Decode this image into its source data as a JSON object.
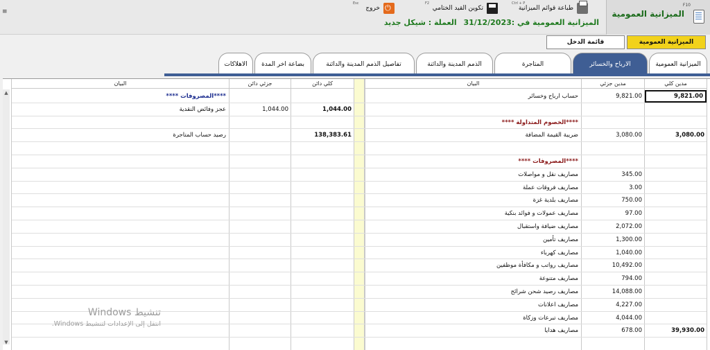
{
  "window": {
    "title": "الميزانية العمومية",
    "shortcut": "F10"
  },
  "toolbar": {
    "print_label": "طباعة قوائم الميزانية",
    "print_shortcut": "Ctrl + P",
    "closing_entry_label": "تكوين القيد الختامي",
    "closing_entry_shortcut": "F2",
    "exit_label": "خروج",
    "exit_shortcut": "Esc"
  },
  "subline": {
    "balance_date": "الميزانية العمومية في :31/12/2023",
    "currency": "العملة : شيكل جديد"
  },
  "report_buttons": {
    "balance_sheet": "الميزانية العمومية",
    "income_statement": "قائمة الدخل"
  },
  "tabs": [
    "الميزانية العمومية",
    "الارباح والخسائر",
    "المتاجرة",
    "الذمم المدينة والدائنة",
    "تفاصيل الذمم المدينة والدائنة",
    "بضاعة اخر المدة",
    "الاهلاكات"
  ],
  "grid": {
    "headers": {
      "debit_total": "مدين كلي",
      "debit_partial": "مدين جزئي",
      "desc_right": "البيان",
      "credit_total": "كلي دائن",
      "credit_partial": "جزئي دائن",
      "desc_left": "البيان"
    },
    "right_rows": [
      {
        "desc": "حساب ارباح وخسائر",
        "partial": "9,821.00",
        "total": "9,821.00",
        "style": "normal"
      },
      {
        "desc": "",
        "partial": "",
        "total": "",
        "style": "normal"
      },
      {
        "desc": "****الخصوم المتداولة ****",
        "partial": "",
        "total": "",
        "style": "red"
      },
      {
        "desc": "ضريبة القيمة المضافة",
        "partial": "3,080.00",
        "total": "3,080.00",
        "style": "normal"
      },
      {
        "desc": "",
        "partial": "",
        "total": "",
        "style": "normal"
      },
      {
        "desc": "****المصروفات ****",
        "partial": "",
        "total": "",
        "style": "red"
      },
      {
        "desc": "مصاريف نقل و مواصلات",
        "partial": "345.00",
        "total": "",
        "style": "normal"
      },
      {
        "desc": "مصاريف فروقات عملة",
        "partial": "3.00",
        "total": "",
        "style": "normal"
      },
      {
        "desc": "مصاريف بلدية غزة",
        "partial": "750.00",
        "total": "",
        "style": "normal"
      },
      {
        "desc": "مصاريف عمولات و فوائد بنكية",
        "partial": "97.00",
        "total": "",
        "style": "normal"
      },
      {
        "desc": "مصاريف ضيافة واستقبال",
        "partial": "2,072.00",
        "total": "",
        "style": "normal"
      },
      {
        "desc": "مصاريف تأمين",
        "partial": "1,300.00",
        "total": "",
        "style": "normal"
      },
      {
        "desc": "مصاريف كهرباء",
        "partial": "1,040.00",
        "total": "",
        "style": "normal"
      },
      {
        "desc": "مصاريف رواتب و مكافأة موظفين",
        "partial": "10,492.00",
        "total": "",
        "style": "normal"
      },
      {
        "desc": "مصاريف متنوعة",
        "partial": "794.00",
        "total": "",
        "style": "normal"
      },
      {
        "desc": "مصاريف رصيد شحن شرائح",
        "partial": "14,088.00",
        "total": "",
        "style": "normal"
      },
      {
        "desc": "مصاريف اعلانات",
        "partial": "4,227.00",
        "total": "",
        "style": "normal"
      },
      {
        "desc": "مصاريف تبرعات وزكاة",
        "partial": "4,044.00",
        "total": "",
        "style": "normal"
      },
      {
        "desc": "مصاريف هدايا",
        "partial": "678.00",
        "total": "39,930.00",
        "style": "normal"
      }
    ],
    "left_rows": [
      {
        "desc": "****المصروفات ****",
        "partial": "",
        "total": "",
        "style": "blue"
      },
      {
        "desc": "عجز وفائض النقدية",
        "partial": "1,044.00",
        "total": "1,044.00",
        "style": "normal"
      },
      {
        "desc": "",
        "partial": "",
        "total": "",
        "style": "normal"
      },
      {
        "desc": "رصيد حساب المتاجرة",
        "partial": "",
        "total": "138,383.61",
        "style": "normal"
      }
    ]
  },
  "watermark": {
    "line1": "تنشيط Windows",
    "line2": "انتقل إلى الإعدادات لتنشيط Windows."
  }
}
